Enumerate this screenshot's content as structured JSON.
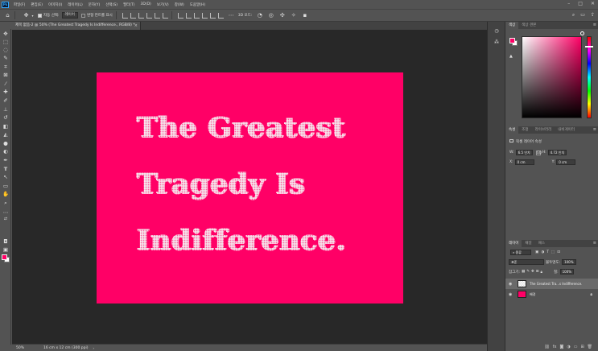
{
  "menubar": {
    "logo": "Ps",
    "items": [
      "파일(F)",
      "편집(E)",
      "이미지(I)",
      "레이어(L)",
      "문자(Y)",
      "선택(S)",
      "필터(T)",
      "3D(D)",
      "보기(V)",
      "창(W)",
      "도움말(H)"
    ],
    "minimize": "–",
    "maximize": "□",
    "close": "✕"
  },
  "options": {
    "auto_select_label": "자동 선택:",
    "layer_select": "레이어",
    "transform_label": "변형 컨트롤 표시",
    "mode_3d": "3D 모드:"
  },
  "document": {
    "tab_title": "제목 없음-2 @ 50% (The Greatest Tragedy Is  Indifference., RGB/8) *",
    "close": "×"
  },
  "artwork": {
    "lines": [
      "The Greatest",
      "Tragedy Is",
      "Indifference."
    ],
    "background_color": "#ff0066"
  },
  "status": {
    "zoom": "50%",
    "doc_size": "16 cm x 12 cm (300 ppi)",
    "arrow": "›"
  },
  "panels": {
    "color_tabs": [
      "색상",
      "색상 견본"
    ],
    "properties_tabs": [
      "속성",
      "조정",
      "라이브러리",
      "내비게이터"
    ],
    "properties_heading": "픽셀 레이어 속성",
    "props": {
      "w_label": "W:",
      "w_value": "6.5 인치",
      "link": "GO",
      "h_label": "H:",
      "h_value": "4.72 인치",
      "x_label": "X:",
      "x_value": "0 cm",
      "y_label": "Y:",
      "y_value": "0 cm"
    },
    "layers_tabs": [
      "레이어",
      "채널",
      "패스"
    ],
    "layers": {
      "filter_kind": "종류",
      "blend_mode": "표준",
      "opacity_label": "불투명도:",
      "opacity_value": "100%",
      "lock_label": "잠그기:",
      "fill_label": "칠:",
      "fill_value": "100%",
      "items": [
        {
          "name": "The Greatest Tra...s  Indifference."
        },
        {
          "name": "배경"
        }
      ]
    },
    "menu": "≡"
  },
  "colors": {
    "foreground": "#ff0066",
    "background": "#ffffff"
  }
}
